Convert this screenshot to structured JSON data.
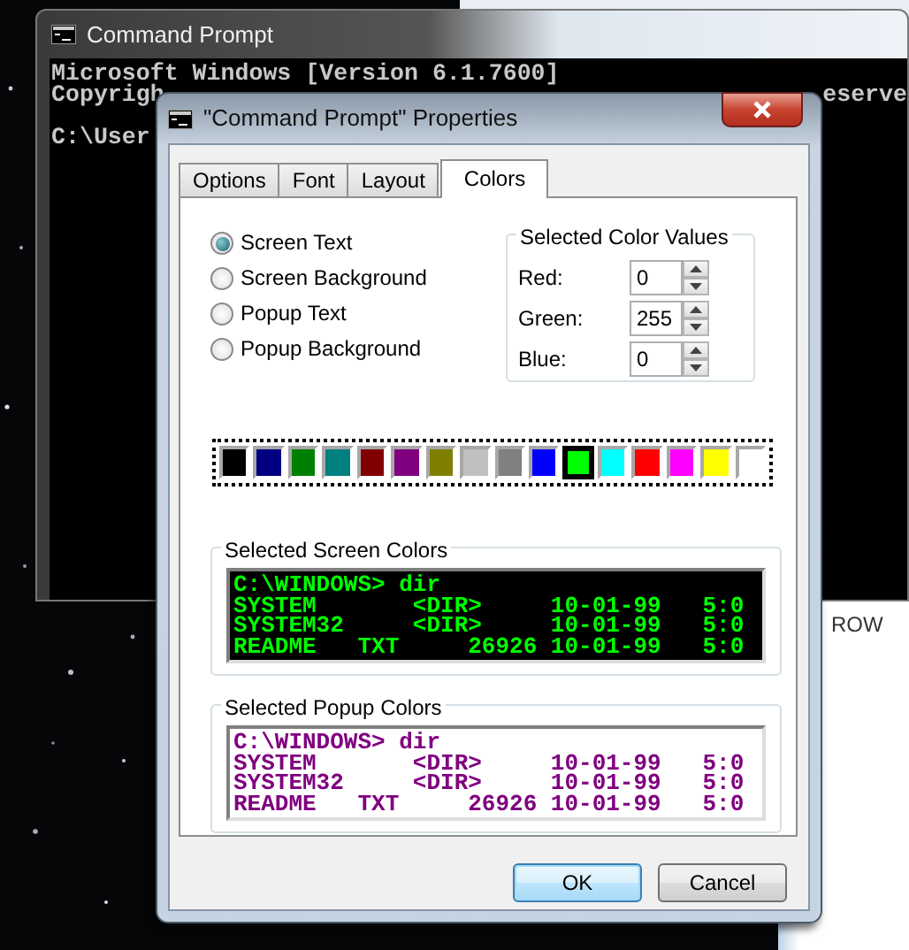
{
  "console_window": {
    "title": "Command Prompt",
    "lines": [
      "Microsoft Windows [Version 6.1.7600]",
      "Copyrigh",
      "C:\\User"
    ],
    "line_end": "eserve"
  },
  "background_window": {
    "text": "ROW"
  },
  "dialog": {
    "title": "\"Command Prompt\" Properties"
  },
  "tabs": [
    {
      "label": "Options",
      "selected": false
    },
    {
      "label": "Font",
      "selected": false
    },
    {
      "label": "Layout",
      "selected": false
    },
    {
      "label": "Colors",
      "selected": true
    }
  ],
  "color_targets": [
    {
      "label": "Screen Text",
      "selected": true
    },
    {
      "label": "Screen Background",
      "selected": false
    },
    {
      "label": "Popup Text",
      "selected": false
    },
    {
      "label": "Popup Background",
      "selected": false
    }
  ],
  "color_values": {
    "title": "Selected Color Values",
    "fields": [
      {
        "label": "Red:",
        "value": "0"
      },
      {
        "label": "Green:",
        "value": "255"
      },
      {
        "label": "Blue:",
        "value": "0"
      }
    ]
  },
  "palette": [
    {
      "color": "#000000",
      "selected": false
    },
    {
      "color": "#000080",
      "selected": false
    },
    {
      "color": "#008000",
      "selected": false
    },
    {
      "color": "#008080",
      "selected": false
    },
    {
      "color": "#800000",
      "selected": false
    },
    {
      "color": "#800080",
      "selected": false
    },
    {
      "color": "#808000",
      "selected": false
    },
    {
      "color": "#c0c0c0",
      "selected": false
    },
    {
      "color": "#808080",
      "selected": false
    },
    {
      "color": "#0000ff",
      "selected": false
    },
    {
      "color": "#00ff00",
      "selected": true
    },
    {
      "color": "#00ffff",
      "selected": false
    },
    {
      "color": "#ff0000",
      "selected": false
    },
    {
      "color": "#ff00ff",
      "selected": false
    },
    {
      "color": "#ffff00",
      "selected": false
    },
    {
      "color": "#ffffff",
      "selected": false
    }
  ],
  "previews": [
    {
      "title": "Selected Screen Colors",
      "kind": "screen",
      "color": "#00ff00",
      "lines": [
        "C:\\WINDOWS> dir",
        "SYSTEM       <DIR>     10-01-99   5:0",
        "SYSTEM32     <DIR>     10-01-99   5:0",
        "README   TXT     26926 10-01-99   5:0"
      ]
    },
    {
      "title": "Selected Popup Colors",
      "kind": "popup",
      "color": "#800080",
      "lines": [
        "C:\\WINDOWS> dir",
        "SYSTEM       <DIR>     10-01-99   5:0",
        "SYSTEM32     <DIR>     10-01-99   5:0",
        "README   TXT     26926 10-01-99   5:0"
      ]
    }
  ],
  "buttons": [
    {
      "label": "OK",
      "kind": "default"
    },
    {
      "label": "Cancel",
      "kind": "normal"
    }
  ]
}
